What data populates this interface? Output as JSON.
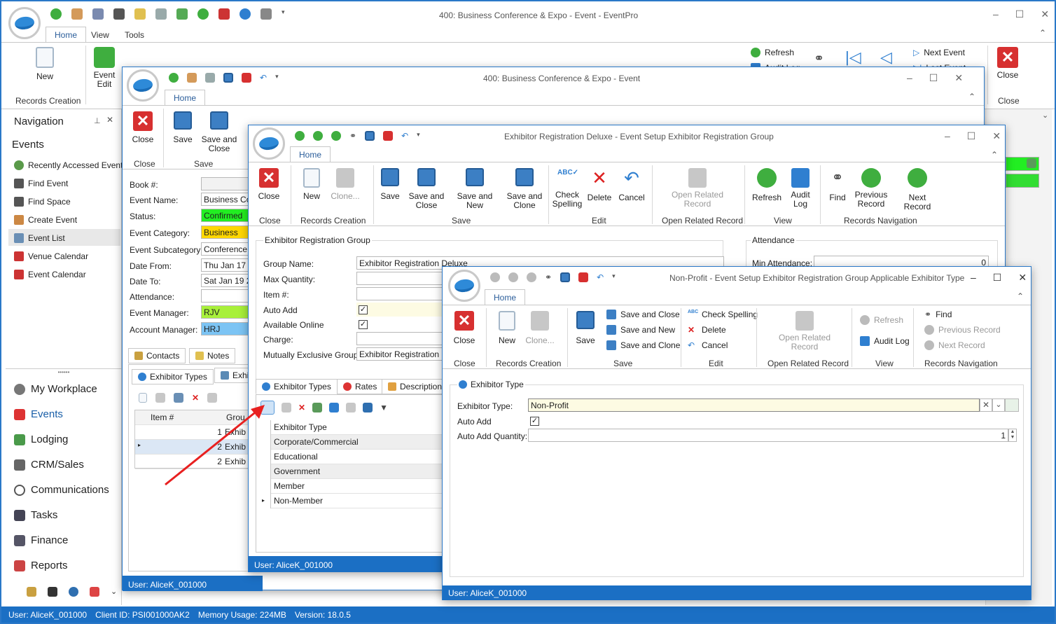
{
  "main": {
    "title": "400: Business Conference & Expo - Event - EventPro",
    "tabs": [
      "Home",
      "View",
      "Tools"
    ],
    "ribbon": {
      "new": "New",
      "event_edit": "Event\nEdit",
      "records_creation": "Records Creation",
      "refresh": "Refresh",
      "audit_log": "Audit Log",
      "next_event": "Next Event",
      "last_event": "Last Event",
      "close": "Close",
      "close_group": "Close"
    }
  },
  "nav": {
    "title": "Navigation",
    "section": "Events",
    "items": [
      "Recently Accessed Events",
      "Find Event",
      "Find Space",
      "Create Event",
      "Event List",
      "Venue Calendar",
      "Event Calendar"
    ],
    "modules": [
      "My Workplace",
      "Events",
      "Lodging",
      "CRM/Sales",
      "Communications",
      "Tasks",
      "Finance",
      "Reports"
    ]
  },
  "statusbar": {
    "user": "User: AliceK_001000",
    "client": "Client ID: PSI001000AK2",
    "memory": "Memory Usage: 224MB",
    "version": "Version: 18.0.5"
  },
  "win2": {
    "title": "400: Business Conference & Expo - Event",
    "tab": "Home",
    "buttons": {
      "close": "Close",
      "save": "Save",
      "save_close": "Save and\nClose"
    },
    "groups": {
      "close": "Close",
      "save": "Save"
    },
    "fields": [
      {
        "label": "Book #:",
        "value": ""
      },
      {
        "label": "Event Name:",
        "value": "Business Con"
      },
      {
        "label": "Status:",
        "value": "Confirmed",
        "color": "#22ee22"
      },
      {
        "label": "Event Category:",
        "value": "Business",
        "color": "#ffd700"
      },
      {
        "label": "Event Subcategory:",
        "value": "Conference w"
      },
      {
        "label": "Date From:",
        "value": "Thu Jan 17 2"
      },
      {
        "label": "Date To:",
        "value": "Sat Jan 19 20"
      },
      {
        "label": "Attendance:",
        "value": ""
      },
      {
        "label": "Event Manager:",
        "value": "RJV",
        "color": "#a8f03a"
      },
      {
        "label": "Account Manager:",
        "value": "HRJ",
        "color": "#7cc4f4"
      }
    ],
    "tabs": [
      "Contacts",
      "Notes"
    ],
    "subtabs": [
      "Exhibitor Types",
      "Exhi"
    ],
    "grid_header": [
      "Item #",
      "Grou"
    ],
    "grid_rows": [
      [
        "1",
        "Exhib"
      ],
      [
        "2",
        "Exhib"
      ],
      [
        "2",
        "Exhib"
      ]
    ],
    "user": "User: AliceK_001000"
  },
  "win3": {
    "title": "Exhibitor Registration Deluxe - Event Setup Exhibitor Registration Group",
    "tab": "Home",
    "buttons": {
      "close": "Close",
      "new": "New",
      "clone": "Clone...",
      "save": "Save",
      "save_close": "Save and\nClose",
      "save_new": "Save and New",
      "save_clone": "Save and\nClone",
      "check": "Check\nSpelling",
      "delete": "Delete",
      "cancel": "Cancel",
      "open_related": "Open Related\nRecord",
      "refresh": "Refresh",
      "audit": "Audit\nLog",
      "find": "Find",
      "prev": "Previous\nRecord",
      "next": "Next Record"
    },
    "groups": {
      "close": "Close",
      "records": "Records Creation",
      "save": "Save",
      "edit": "Edit",
      "open_related": "Open Related Record",
      "view": "View",
      "nav": "Records Navigation"
    },
    "section": "Exhibitor Registration Group",
    "fields": [
      {
        "label": "Group Name:",
        "value": "Exhibitor Registration Deluxe"
      },
      {
        "label": "Max Quantity:",
        "value": ""
      },
      {
        "label": "Item #:",
        "value": ""
      },
      {
        "label": "Auto Add",
        "value": "✓"
      },
      {
        "label": "Available Online",
        "value": "✓"
      },
      {
        "label": "Charge:",
        "value": ""
      },
      {
        "label": "Mutually Exclusive Groups:",
        "value": "Exhibitor Registration Ba"
      }
    ],
    "attendance": {
      "title": "Attendance",
      "min_label": "Min Attendance:",
      "min_value": "0"
    },
    "tabs": [
      "Exhibitor Types",
      "Rates",
      "Description"
    ],
    "grid_header": "Exhibitor Type",
    "grid_rows": [
      "Corporate/Commercial",
      "Educational",
      "Government",
      "Member",
      "Non-Member"
    ],
    "user": "User: AliceK_001000"
  },
  "win4": {
    "title": "Non-Profit - Event Setup Exhibitor Registration Group Applicable Exhibitor Type",
    "tab": "Home",
    "buttons": {
      "close": "Close",
      "new": "New",
      "clone": "Clone...",
      "save": "Save",
      "save_close": "Save and Close",
      "save_new": "Save and New",
      "save_clone": "Save and Clone",
      "check": "Check Spelling",
      "delete": "Delete",
      "cancel": "Cancel",
      "open_related": "Open Related\nRecord",
      "refresh": "Refresh",
      "audit": "Audit Log",
      "find": "Find",
      "prev": "Previous Record",
      "next": "Next Record"
    },
    "groups": {
      "close": "Close",
      "records": "Records Creation",
      "save": "Save",
      "edit": "Edit",
      "open_related": "Open Related Record",
      "view": "View",
      "nav": "Records Navigation"
    },
    "section": "Exhibitor Type",
    "type_label": "Exhibitor Type:",
    "type_value": "Non-Profit",
    "auto_add_label": "Auto Add",
    "auto_add_value": "✓",
    "qty_label": "Auto Add Quantity:",
    "qty_value": "1",
    "user": "User: AliceK_001000"
  }
}
